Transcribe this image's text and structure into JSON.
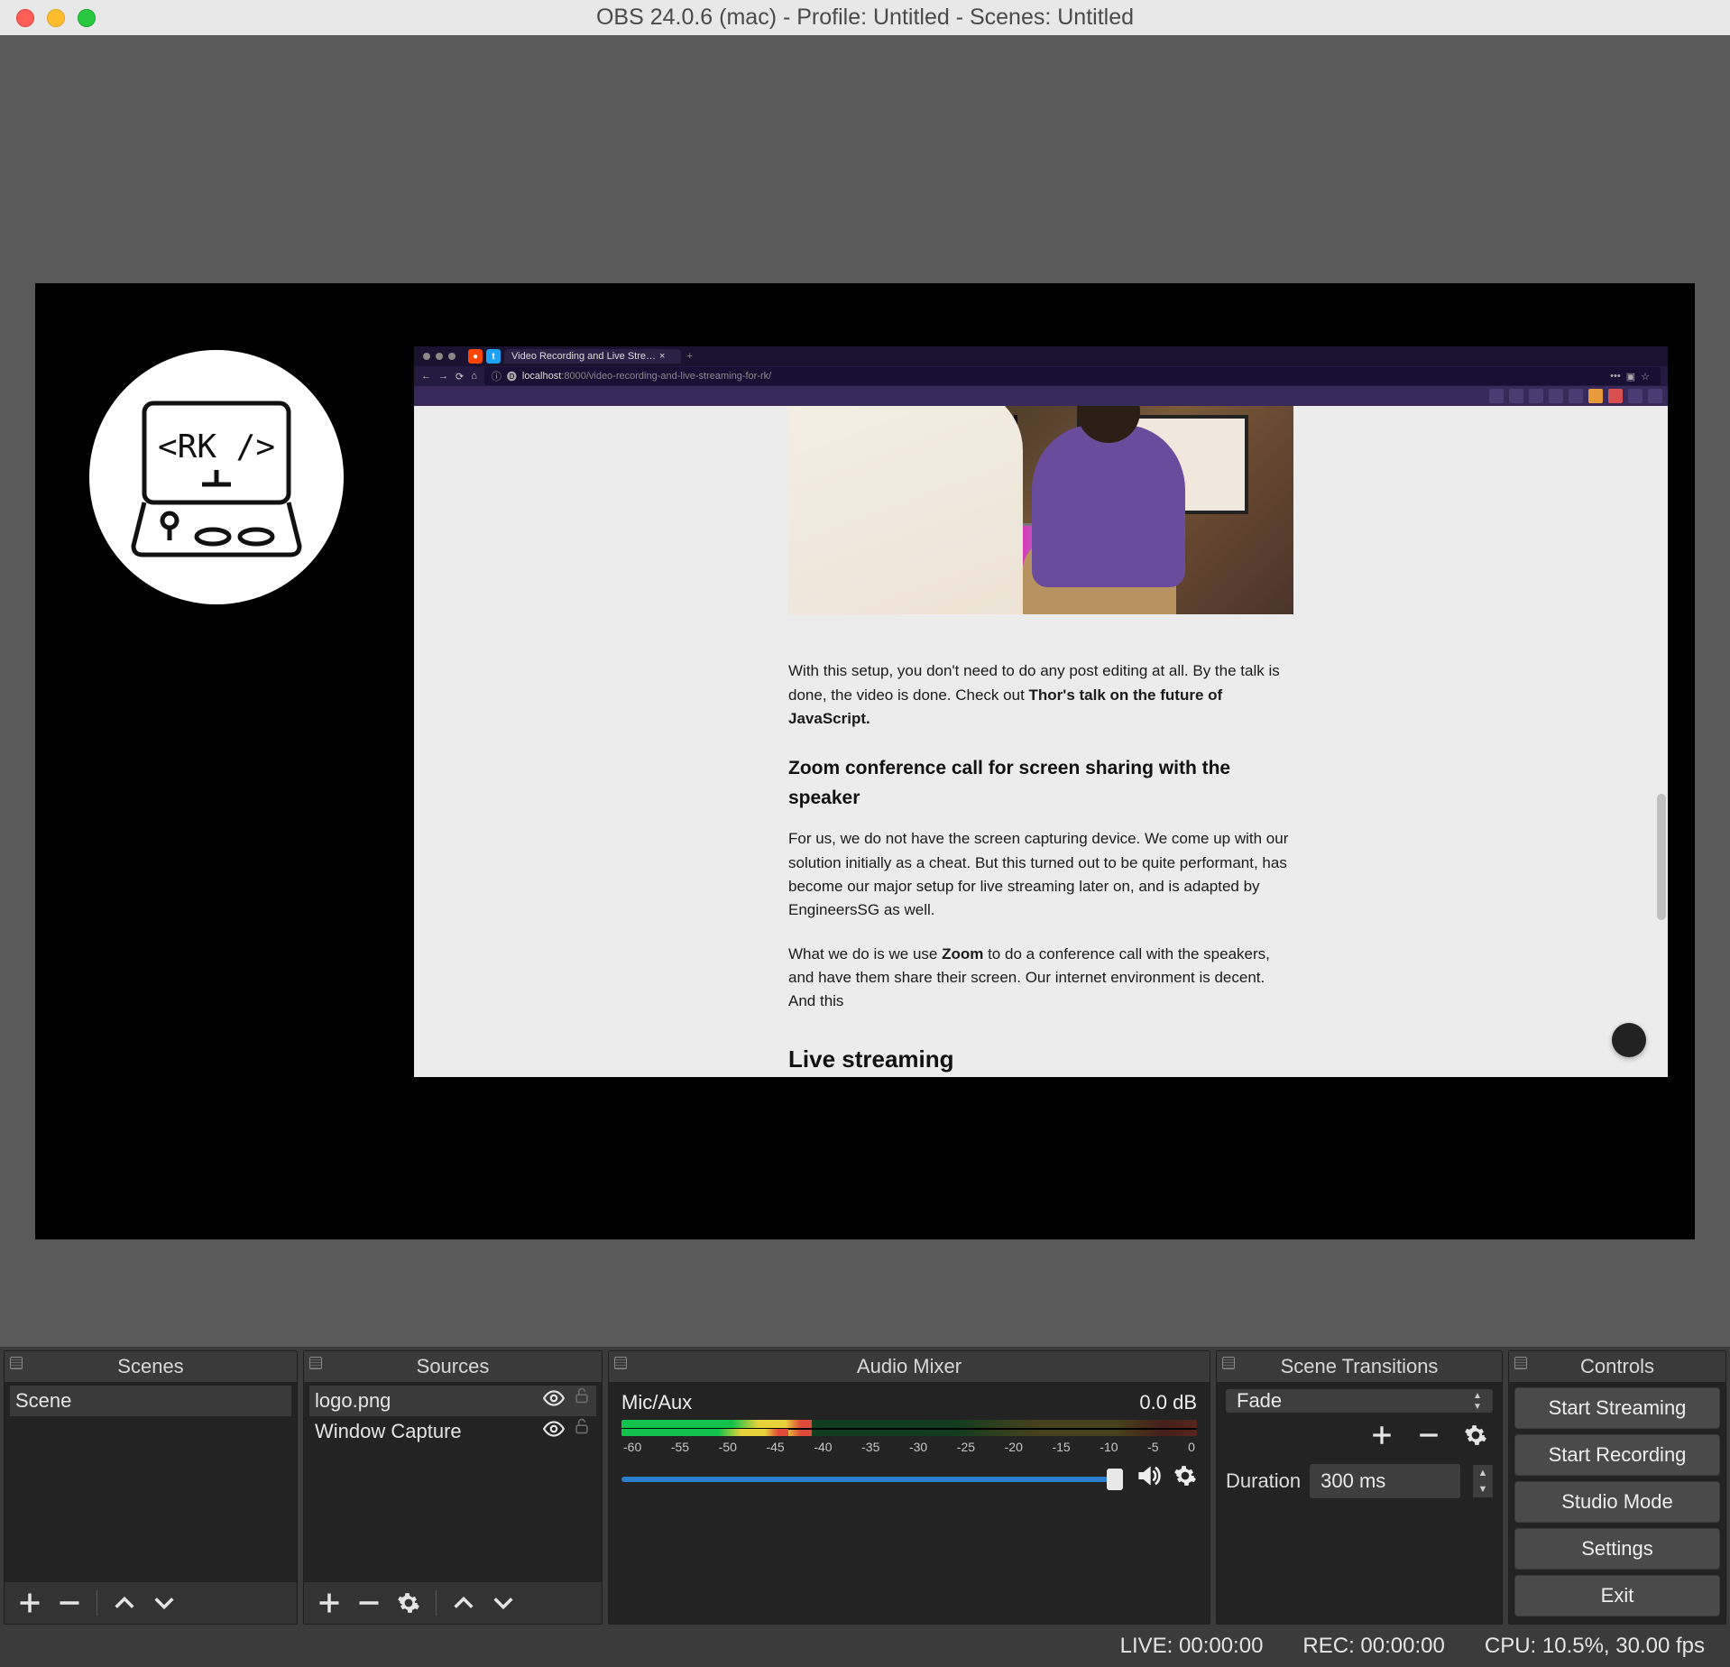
{
  "titlebar": {
    "title": "OBS 24.0.6 (mac) - Profile: Untitled - Scenes: Untitled"
  },
  "preview": {
    "logo_text": "<RK />",
    "browser": {
      "tab_title": "Video Recording and Live Stre…",
      "url_host": "localhost",
      "url_path": ":8000/video-recording-and-live-streaming-for-rk/",
      "article": {
        "p1a": "With this setup, you don't need to do any post editing at all. By the talk is done, the video is done. Check out ",
        "p1b": "Thor's talk on the future of JavaScript.",
        "h3": "Zoom conference call for screen sharing with the speaker",
        "p2": "For us, we do not have the screen capturing device. We come up with our solution initially as a cheat. But this turned out to be quite performant, has become our major setup for live streaming later on, and is adapted by EngineersSG as well.",
        "p3a": "What we do is we use ",
        "p3b": "Zoom",
        "p3c": " to do a conference call with the speakers, and have them share their screen. Our internet environment is decent. And this",
        "h2": "Live streaming"
      }
    }
  },
  "docks": {
    "scenes": {
      "title": "Scenes",
      "items": [
        "Scene"
      ]
    },
    "sources": {
      "title": "Sources",
      "items": [
        "logo.png",
        "Window Capture"
      ]
    },
    "mixer": {
      "title": "Audio Mixer",
      "channel": "Mic/Aux",
      "level": "0.0 dB",
      "ticks": [
        "-60",
        "-55",
        "-50",
        "-45",
        "-40",
        "-35",
        "-30",
        "-25",
        "-20",
        "-15",
        "-10",
        "-5",
        "0"
      ]
    },
    "transitions": {
      "title": "Scene Transitions",
      "selected": "Fade",
      "duration_label": "Duration",
      "duration_value": "300 ms"
    },
    "controls": {
      "title": "Controls",
      "buttons": [
        "Start Streaming",
        "Start Recording",
        "Studio Mode",
        "Settings",
        "Exit"
      ]
    }
  },
  "statusbar": {
    "live": "LIVE: 00:00:00",
    "rec": "REC: 00:00:00",
    "cpu": "CPU: 10.5%, 30.00 fps"
  }
}
